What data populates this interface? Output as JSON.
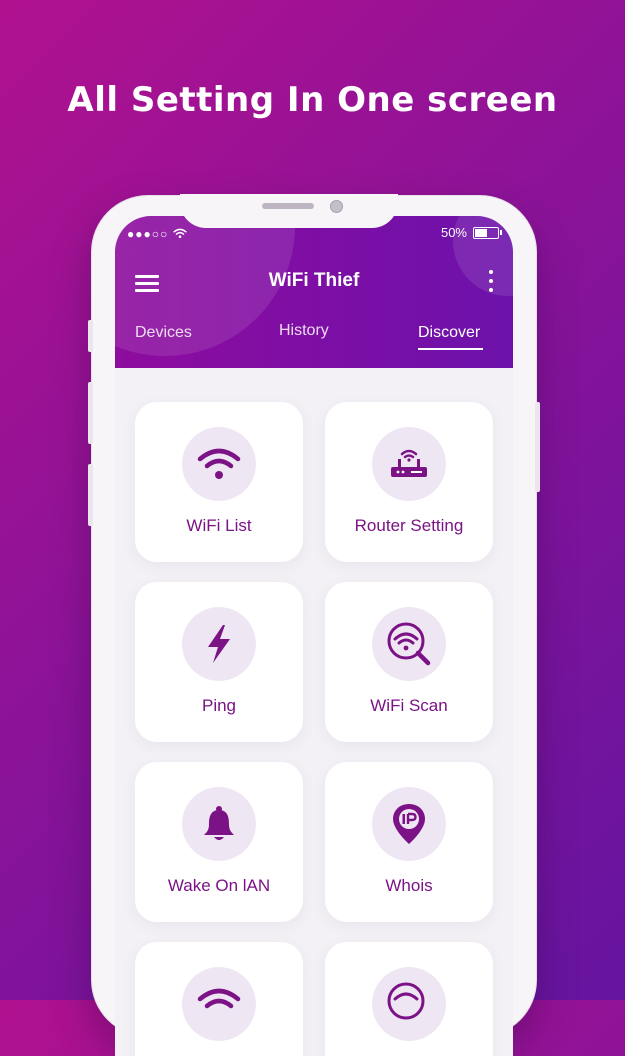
{
  "headline": "All Setting In One screen",
  "status": {
    "signal": "●●●○○",
    "battery": "50%",
    "battery_level": 0.5
  },
  "app": {
    "title": "WiFi Thief"
  },
  "tabs": [
    {
      "label": "Devices"
    },
    {
      "label": "History"
    },
    {
      "label": "Discover"
    }
  ],
  "active_tab": "Discover",
  "cards": [
    {
      "label": "WiFi List",
      "icon": "wifi-icon"
    },
    {
      "label": "Router Setting",
      "icon": "router-icon"
    },
    {
      "label": "Ping",
      "icon": "lightning-icon"
    },
    {
      "label": "WiFi Scan",
      "icon": "wifi-search-icon"
    },
    {
      "label": "Wake On lAN",
      "icon": "bell-icon"
    },
    {
      "label": "Whois",
      "icon": "ip-pin-icon"
    }
  ],
  "colors": {
    "accent": "#7b1386",
    "appbar": "#8e0c9e",
    "icon_bg": "#efe6f3"
  }
}
